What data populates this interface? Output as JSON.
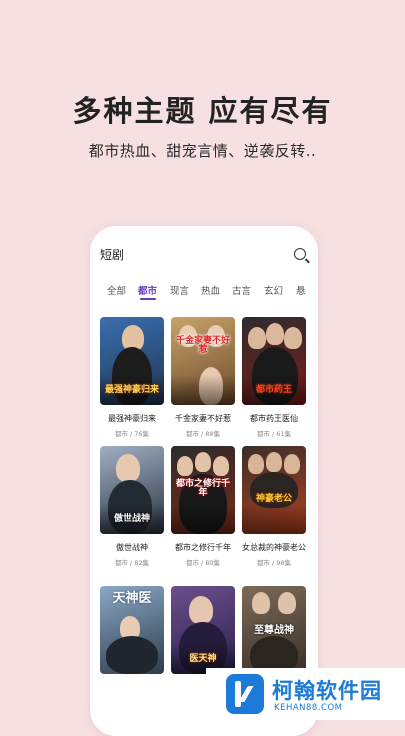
{
  "headline": "多种主题 应有尽有",
  "subline": "都市热血、甜宠言情、逆袭反转..",
  "phone": {
    "search_title": "短剧",
    "search_icon": "search-icon",
    "tabs": [
      {
        "label": "全部"
      },
      {
        "label": "都市"
      },
      {
        "label": "现言"
      },
      {
        "label": "热血"
      },
      {
        "label": "古言"
      },
      {
        "label": "玄幻"
      },
      {
        "label": "悬"
      }
    ],
    "active_tab": "都市",
    "accent_color": "#6a3cc2",
    "dramas": [
      {
        "title": "最强神豪归来",
        "meta": "都市 / 76集",
        "poster_text": "最强神豪归来",
        "colors": [
          "#3a6fb0",
          "#1e3550"
        ]
      },
      {
        "title": "千金家妻不好惹",
        "meta": "都市 / 88集",
        "poster_text": "千金家妻不好惹",
        "colors": [
          "#c9a36a",
          "#6b4a2a"
        ]
      },
      {
        "title": "都市药王医仙",
        "meta": "都市 / 61集",
        "poster_text": "都市药王",
        "colors": [
          "#2d2d2d",
          "#7a1b1b"
        ]
      },
      {
        "title": "傲世战神",
        "meta": "都市 / 82集",
        "poster_text": "傲世战神",
        "colors": [
          "#9fb0c3",
          "#2a3240"
        ]
      },
      {
        "title": "都市之修行千年",
        "meta": "都市 / 80集",
        "poster_text": "都市之修行千年",
        "colors": [
          "#2b2b2b",
          "#7a2a18"
        ]
      },
      {
        "title": "女总裁的神豪老公",
        "meta": "都市 / 98集",
        "poster_text": "神豪老公",
        "colors": [
          "#3a2f2a",
          "#b0401e"
        ]
      },
      {
        "title": "",
        "meta": "",
        "poster_text": "天神医",
        "colors": [
          "#8aa9c8",
          "#2f3b4a"
        ]
      },
      {
        "title": "",
        "meta": "",
        "poster_text": "医天神",
        "colors": [
          "#6b4f8a",
          "#2a2050"
        ]
      },
      {
        "title": "",
        "meta": "",
        "poster_text": "至尊战神",
        "colors": [
          "#7b6a58",
          "#3a302a"
        ]
      }
    ]
  },
  "watermark": {
    "name": "柯翰软件园",
    "domain": "KEHAN88.COM",
    "brand_color": "#1c7ad9"
  }
}
